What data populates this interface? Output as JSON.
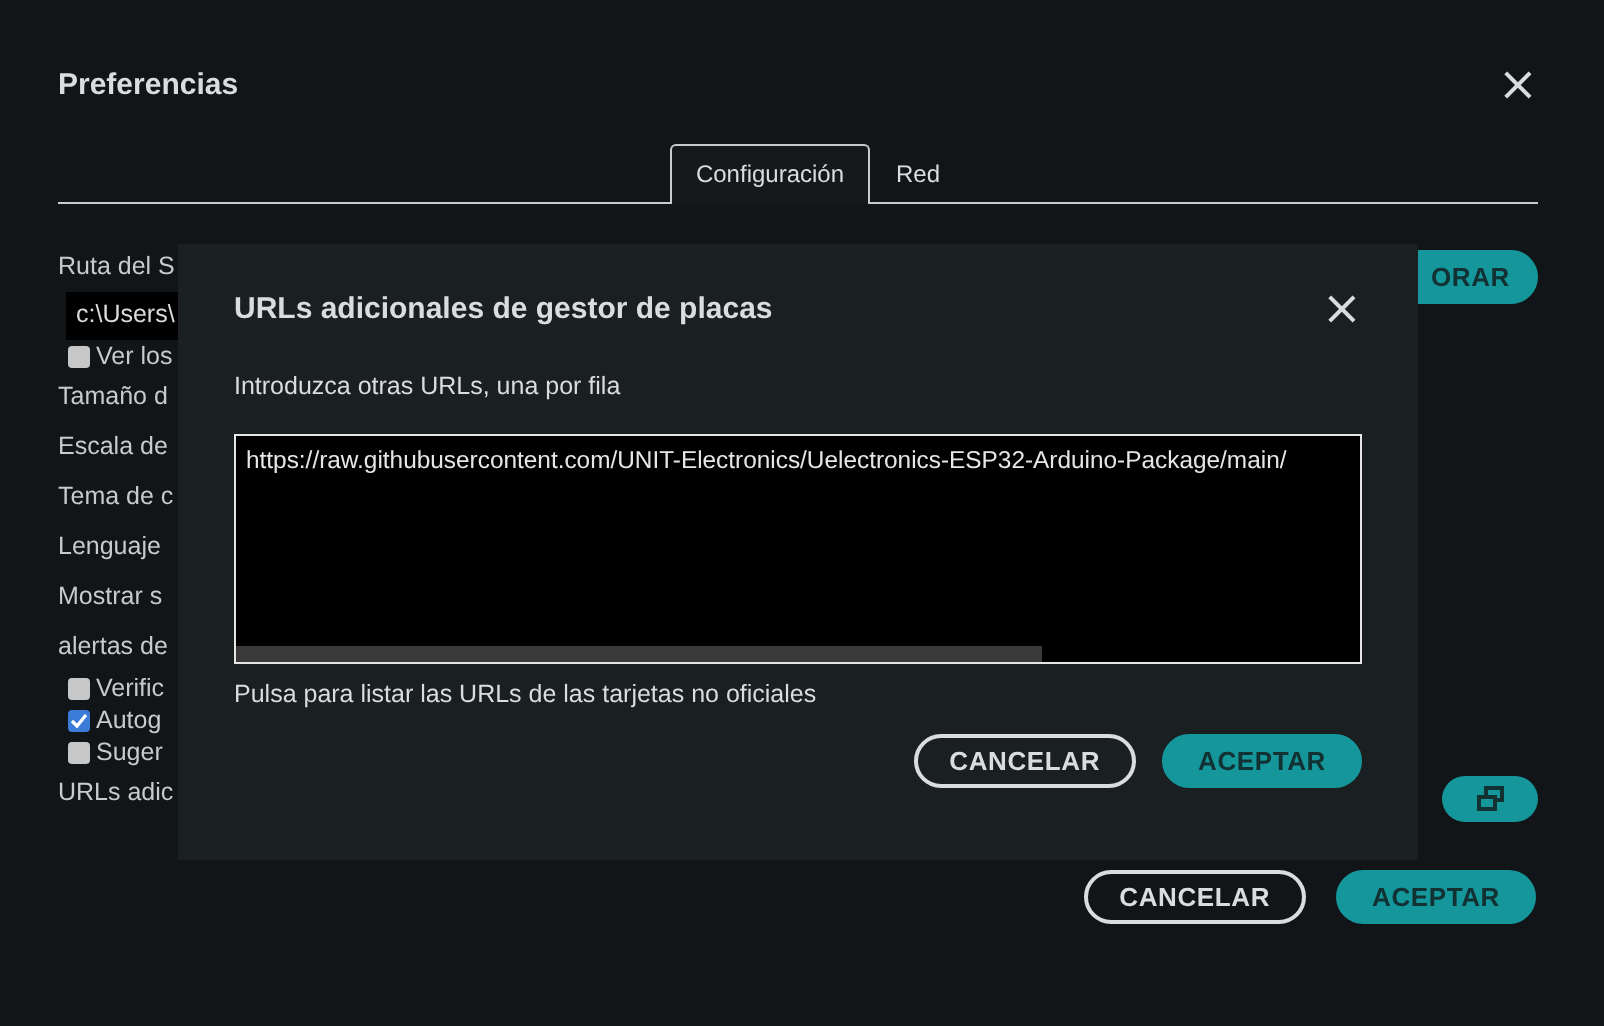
{
  "window": {
    "title": "Preferencias",
    "close": "×"
  },
  "tabs": [
    {
      "label": "Configuración",
      "selected": true
    },
    {
      "label": "Red",
      "selected": false
    }
  ],
  "settings": [
    {
      "kind": "label",
      "text": "Ruta del S"
    },
    {
      "kind": "field",
      "value": "c:\\Users\\"
    },
    {
      "kind": "checkbox",
      "text": "Ver los",
      "checked": false
    },
    {
      "kind": "label",
      "text": "Tamaño d"
    },
    {
      "kind": "label",
      "text": "Escala de"
    },
    {
      "kind": "label",
      "text": "Tema de c"
    },
    {
      "kind": "label",
      "text": "Lenguaje"
    },
    {
      "kind": "label",
      "text": "Mostrar s"
    },
    {
      "kind": "label",
      "text": "alertas de"
    },
    {
      "kind": "checkbox",
      "text": "Verific",
      "checked": false
    },
    {
      "kind": "checkbox",
      "text": "Autog",
      "checked": true
    },
    {
      "kind": "checkbox",
      "text": "Suger",
      "checked": false
    },
    {
      "kind": "label",
      "text": "URLs adic"
    }
  ],
  "browse_button": "ORAR",
  "buttons": [
    {
      "label": "CANCELAR",
      "kind": "outline"
    },
    {
      "label": "ACEPTAR",
      "kind": "filled"
    }
  ],
  "dialog": {
    "title": "URLs adicionales de gestor de placas",
    "close": "×",
    "prompt": "Introduzca otras URLs, una por fila",
    "urls": "https://raw.githubusercontent.com/UNIT-Electronics/Uelectronics-ESP32-Arduino-Package/main/",
    "link": "Pulsa para listar las URLs de las tarjetas no oficiales",
    "buttons": [
      {
        "label": "CANCELAR",
        "kind": "outline"
      },
      {
        "label": "ACEPTAR",
        "kind": "filled"
      }
    ]
  }
}
